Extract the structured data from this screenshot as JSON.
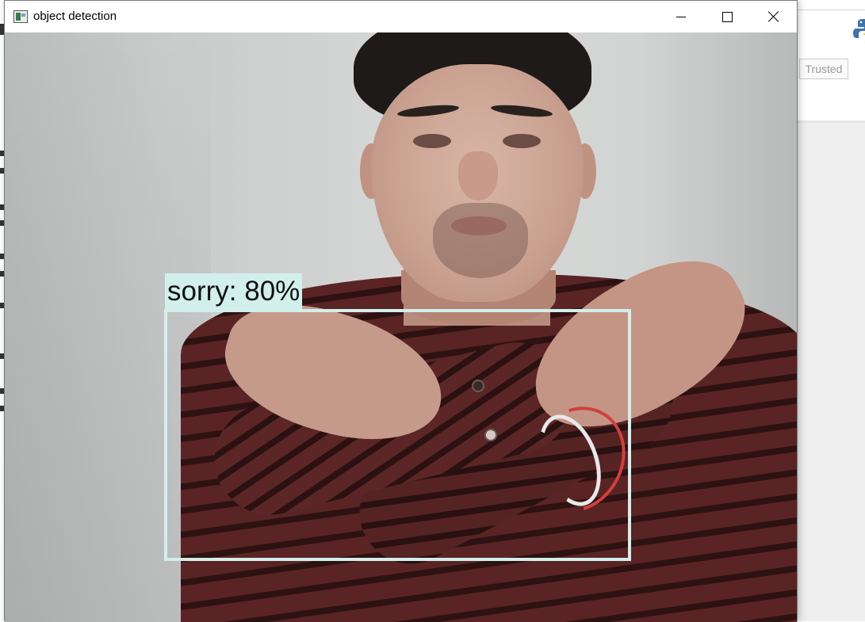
{
  "window": {
    "title": "object detection",
    "icon": "app-window-icon",
    "controls": {
      "minimize": "minimize-icon",
      "maximize": "maximize-icon",
      "close": "close-icon"
    }
  },
  "detection": {
    "label": "sorry: 80%",
    "class": "sorry",
    "confidence_percent": 80,
    "box_color": "#d2efec"
  },
  "background_app": {
    "trusted_label": "Trusted",
    "logo_icon": "python-logo-icon"
  }
}
